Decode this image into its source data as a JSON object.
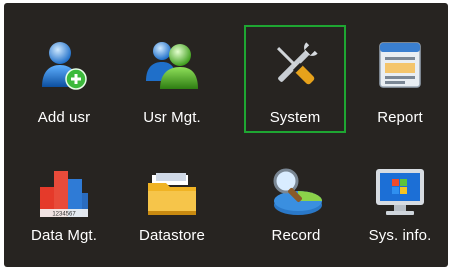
{
  "menu": {
    "items": [
      {
        "label": "Add usr",
        "icon": "add-user-icon"
      },
      {
        "label": "Usr Mgt.",
        "icon": "users-icon"
      },
      {
        "label": "System",
        "icon": "tools-icon"
      },
      {
        "label": "Report",
        "icon": "report-icon"
      },
      {
        "label": "Data Mgt.",
        "icon": "bar-chart-icon"
      },
      {
        "label": "Datastore",
        "icon": "folder-icon"
      },
      {
        "label": "Record",
        "icon": "search-record-icon"
      },
      {
        "label": "Sys. info.",
        "icon": "monitor-icon"
      }
    ],
    "selected": "System",
    "chart_icon_text": "1234567"
  },
  "colors": {
    "background": "#272421",
    "selection": "#1ea632",
    "text": "#ffffff"
  }
}
